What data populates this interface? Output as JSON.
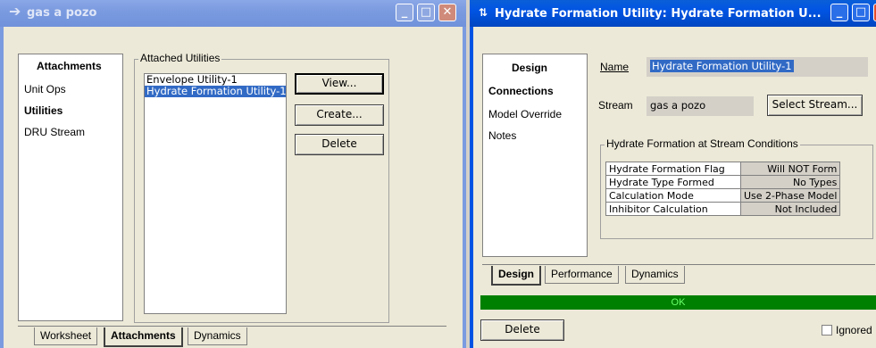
{
  "left_window": {
    "title": "gas a pozo",
    "nav": {
      "header": "Attachments",
      "items": [
        "Unit Ops",
        "Utilities",
        "DRU Stream"
      ]
    },
    "attached_utilities_label": "Attached Utilities",
    "utilities": [
      "Envelope Utility-1",
      "Hydrate Formation Utility-1"
    ],
    "buttons": {
      "view": "View...",
      "create": "Create...",
      "delete": "Delete"
    },
    "tabs": [
      "Worksheet",
      "Attachments",
      "Dynamics"
    ]
  },
  "right_window": {
    "title": "Hydrate Formation Utility: Hydrate Formation U...",
    "nav": {
      "header": "Design",
      "items": [
        "Connections",
        "Model Override",
        "Notes"
      ]
    },
    "name_label": "Name",
    "name_value": "Hydrate Formation Utility-1",
    "stream_label": "Stream",
    "stream_value": "gas a pozo",
    "select_stream_button": "Select Stream...",
    "group_label": "Hydrate Formation at Stream Conditions",
    "table": [
      {
        "key": "Hydrate Formation Flag",
        "value": "Will NOT Form"
      },
      {
        "key": "Hydrate Type Formed",
        "value": "No Types"
      },
      {
        "key": "Calculation Mode",
        "value": "Use 2-Phase Model"
      },
      {
        "key": "Inhibitor Calculation",
        "value": "Not Included"
      }
    ],
    "tabs": [
      "Design",
      "Performance",
      "Dynamics"
    ],
    "status": "OK",
    "delete_button": "Delete",
    "ignored_label": "Ignored"
  }
}
